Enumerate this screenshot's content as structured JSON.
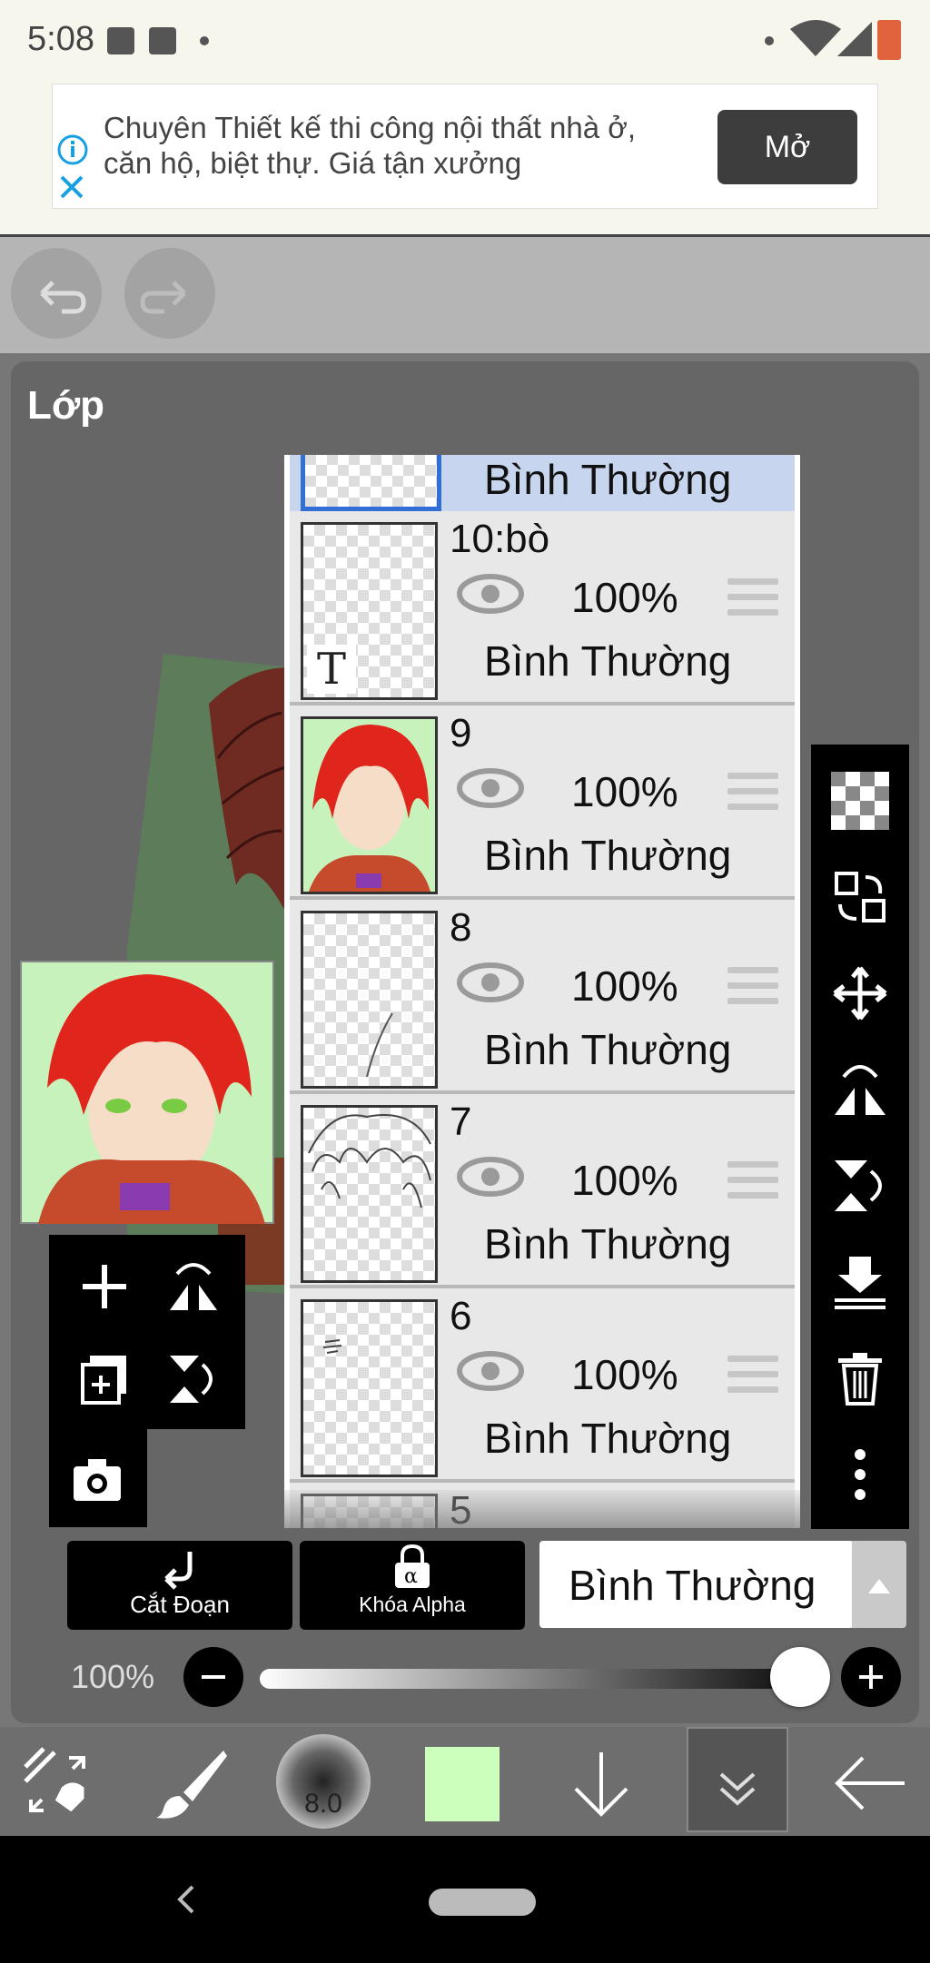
{
  "status_bar": {
    "time": "5:08"
  },
  "ad": {
    "text": "Chuyên Thiết kế thi công nội thất nhà ở, căn hộ, biệt thự. Giá tận xưởng",
    "button_label": "Mở"
  },
  "panel": {
    "title": "Lớp"
  },
  "layers": [
    {
      "name": "",
      "opacity": "",
      "blend": "Bình Thường",
      "selected": true
    },
    {
      "name": "10:bò",
      "opacity": "100%",
      "blend": "Bình Thường",
      "thumb_text": "T"
    },
    {
      "name": "9",
      "opacity": "100%",
      "blend": "Bình Thường"
    },
    {
      "name": "8",
      "opacity": "100%",
      "blend": "Bình Thường"
    },
    {
      "name": "7",
      "opacity": "100%",
      "blend": "Bình Thường"
    },
    {
      "name": "6",
      "opacity": "100%",
      "blend": "Bình Thường"
    },
    {
      "name": "5",
      "opacity": "",
      "blend": ""
    }
  ],
  "controls": {
    "clip_label": "Cắt Đoạn",
    "alpha_lock_label": "Khóa Alpha",
    "blend_mode": "Bình Thường",
    "opacity_label": "100%",
    "opacity_value": 1.0
  },
  "bottom_toolbar": {
    "brush_size": "8.0",
    "color": "#ccffbb"
  },
  "colors": {
    "accent_selected": "#c7d6ee",
    "selected_border": "#2f6fd6"
  }
}
